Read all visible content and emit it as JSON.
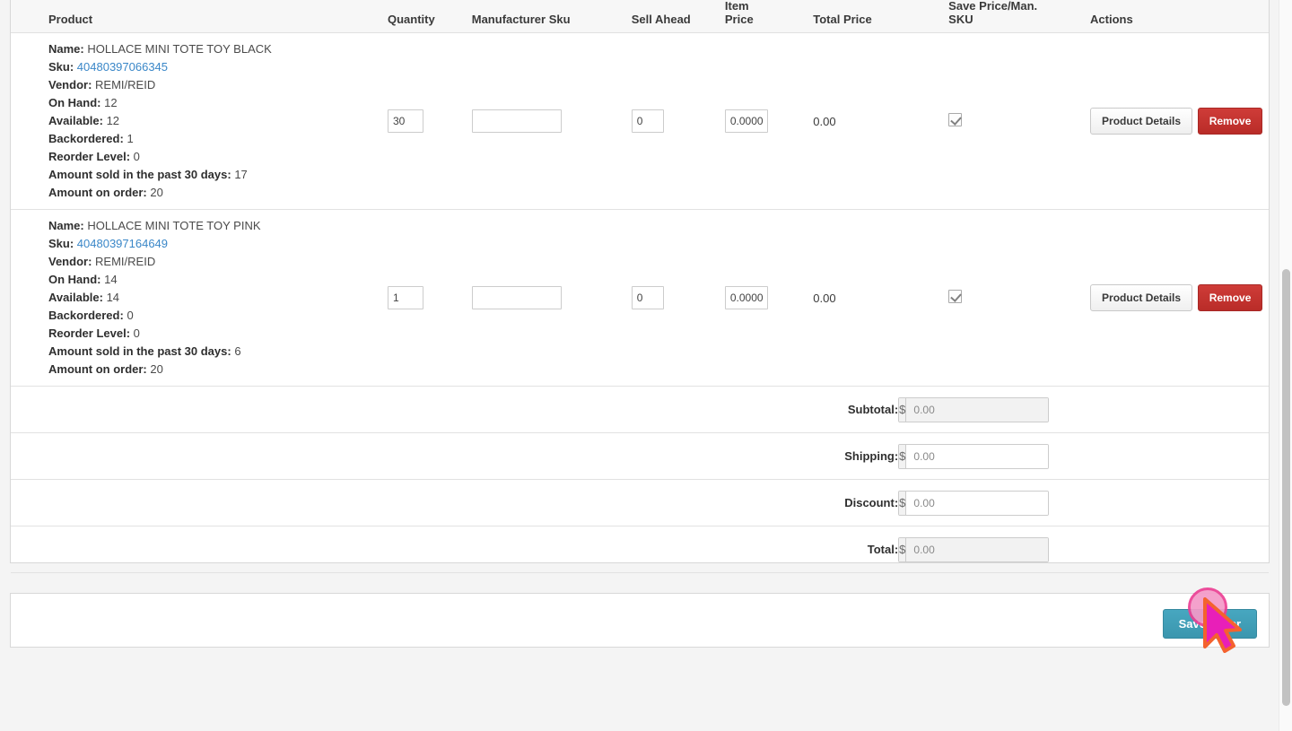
{
  "table": {
    "headers": [
      "Product",
      "Quantity",
      "Manufacturer Sku",
      "Sell Ahead",
      "Item Price",
      "Total Price",
      "Save Price/Man. SKU",
      "Actions"
    ],
    "labels": {
      "name": "Name:",
      "sku": "Sku:",
      "vendor": "Vendor:",
      "on_hand": "On Hand:",
      "available": "Available:",
      "backordered": "Backordered:",
      "reorder_level": "Reorder Level:",
      "sold_30": "Amount sold in the past 30 days:",
      "on_order": "Amount on order:"
    },
    "rows": [
      {
        "name": "HOLLACE MINI TOTE TOY BLACK",
        "sku": "40480397066345",
        "vendor": "REMI/REID",
        "on_hand": "12",
        "available": "12",
        "backordered": "1",
        "reorder_level": "0",
        "sold_30": "17",
        "on_order": "20",
        "quantity": "30",
        "manufacturer_sku": "",
        "manufacturer_sku_placeholder": "",
        "sell_ahead": "0",
        "item_price": "0.0000",
        "total_price": "0.00",
        "save_price_checked": true,
        "details_label": "Product Details",
        "remove_label": "Remove"
      },
      {
        "name": "HOLLACE MINI TOTE TOY PINK",
        "sku": "40480397164649",
        "vendor": "REMI/REID",
        "on_hand": "14",
        "available": "14",
        "backordered": "0",
        "reorder_level": "0",
        "sold_30": "6",
        "on_order": "20",
        "quantity": "1",
        "manufacturer_sku": "",
        "manufacturer_sku_placeholder": "",
        "sell_ahead": "0",
        "item_price": "0.0000",
        "total_price": "0.00",
        "save_price_checked": true,
        "details_label": "Product Details",
        "remove_label": "Remove"
      }
    ]
  },
  "totals": {
    "currency_symbol": "$",
    "rows": [
      {
        "label": "Subtotal:",
        "value": "0.00",
        "readonly": true
      },
      {
        "label": "Shipping:",
        "value": "0.00",
        "readonly": false
      },
      {
        "label": "Discount:",
        "value": "0.00",
        "readonly": false
      },
      {
        "label": "Total:",
        "value": "0.00",
        "readonly": true
      }
    ]
  },
  "footer": {
    "save_order_label": "Save Order"
  },
  "colors": {
    "link": "#3a87c8",
    "danger": "#bf2f2b",
    "primary": "#3b96ae",
    "click_ring": "#ec3f94",
    "cursor": "#e81fb8"
  }
}
